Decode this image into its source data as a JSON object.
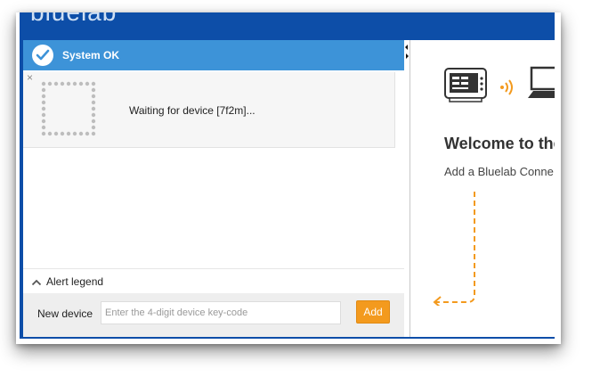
{
  "app": {
    "brand": "bluelab"
  },
  "status": {
    "text": "System OK",
    "icon": "check-circle-icon",
    "color": "#3d93d8"
  },
  "device_card": {
    "close_label": "×",
    "waiting_text": "Waiting for device [7f2m]..."
  },
  "legend": {
    "label": "Alert legend",
    "icon": "chevron-up-icon"
  },
  "new_device": {
    "label": "New device",
    "placeholder": "Enter the 4-digit device key-code",
    "value": "",
    "add_label": "Add",
    "add_color": "#f39a1e"
  },
  "welcome": {
    "title": "Welcome to the",
    "subtitle": "Add a Bluelab Conne",
    "icons": [
      "connect-hub-icon",
      "wireless-signal-icon",
      "laptop-icon"
    ],
    "arrow_color": "#f39a1e"
  },
  "colors": {
    "window_frame": "#0d4ea8"
  }
}
